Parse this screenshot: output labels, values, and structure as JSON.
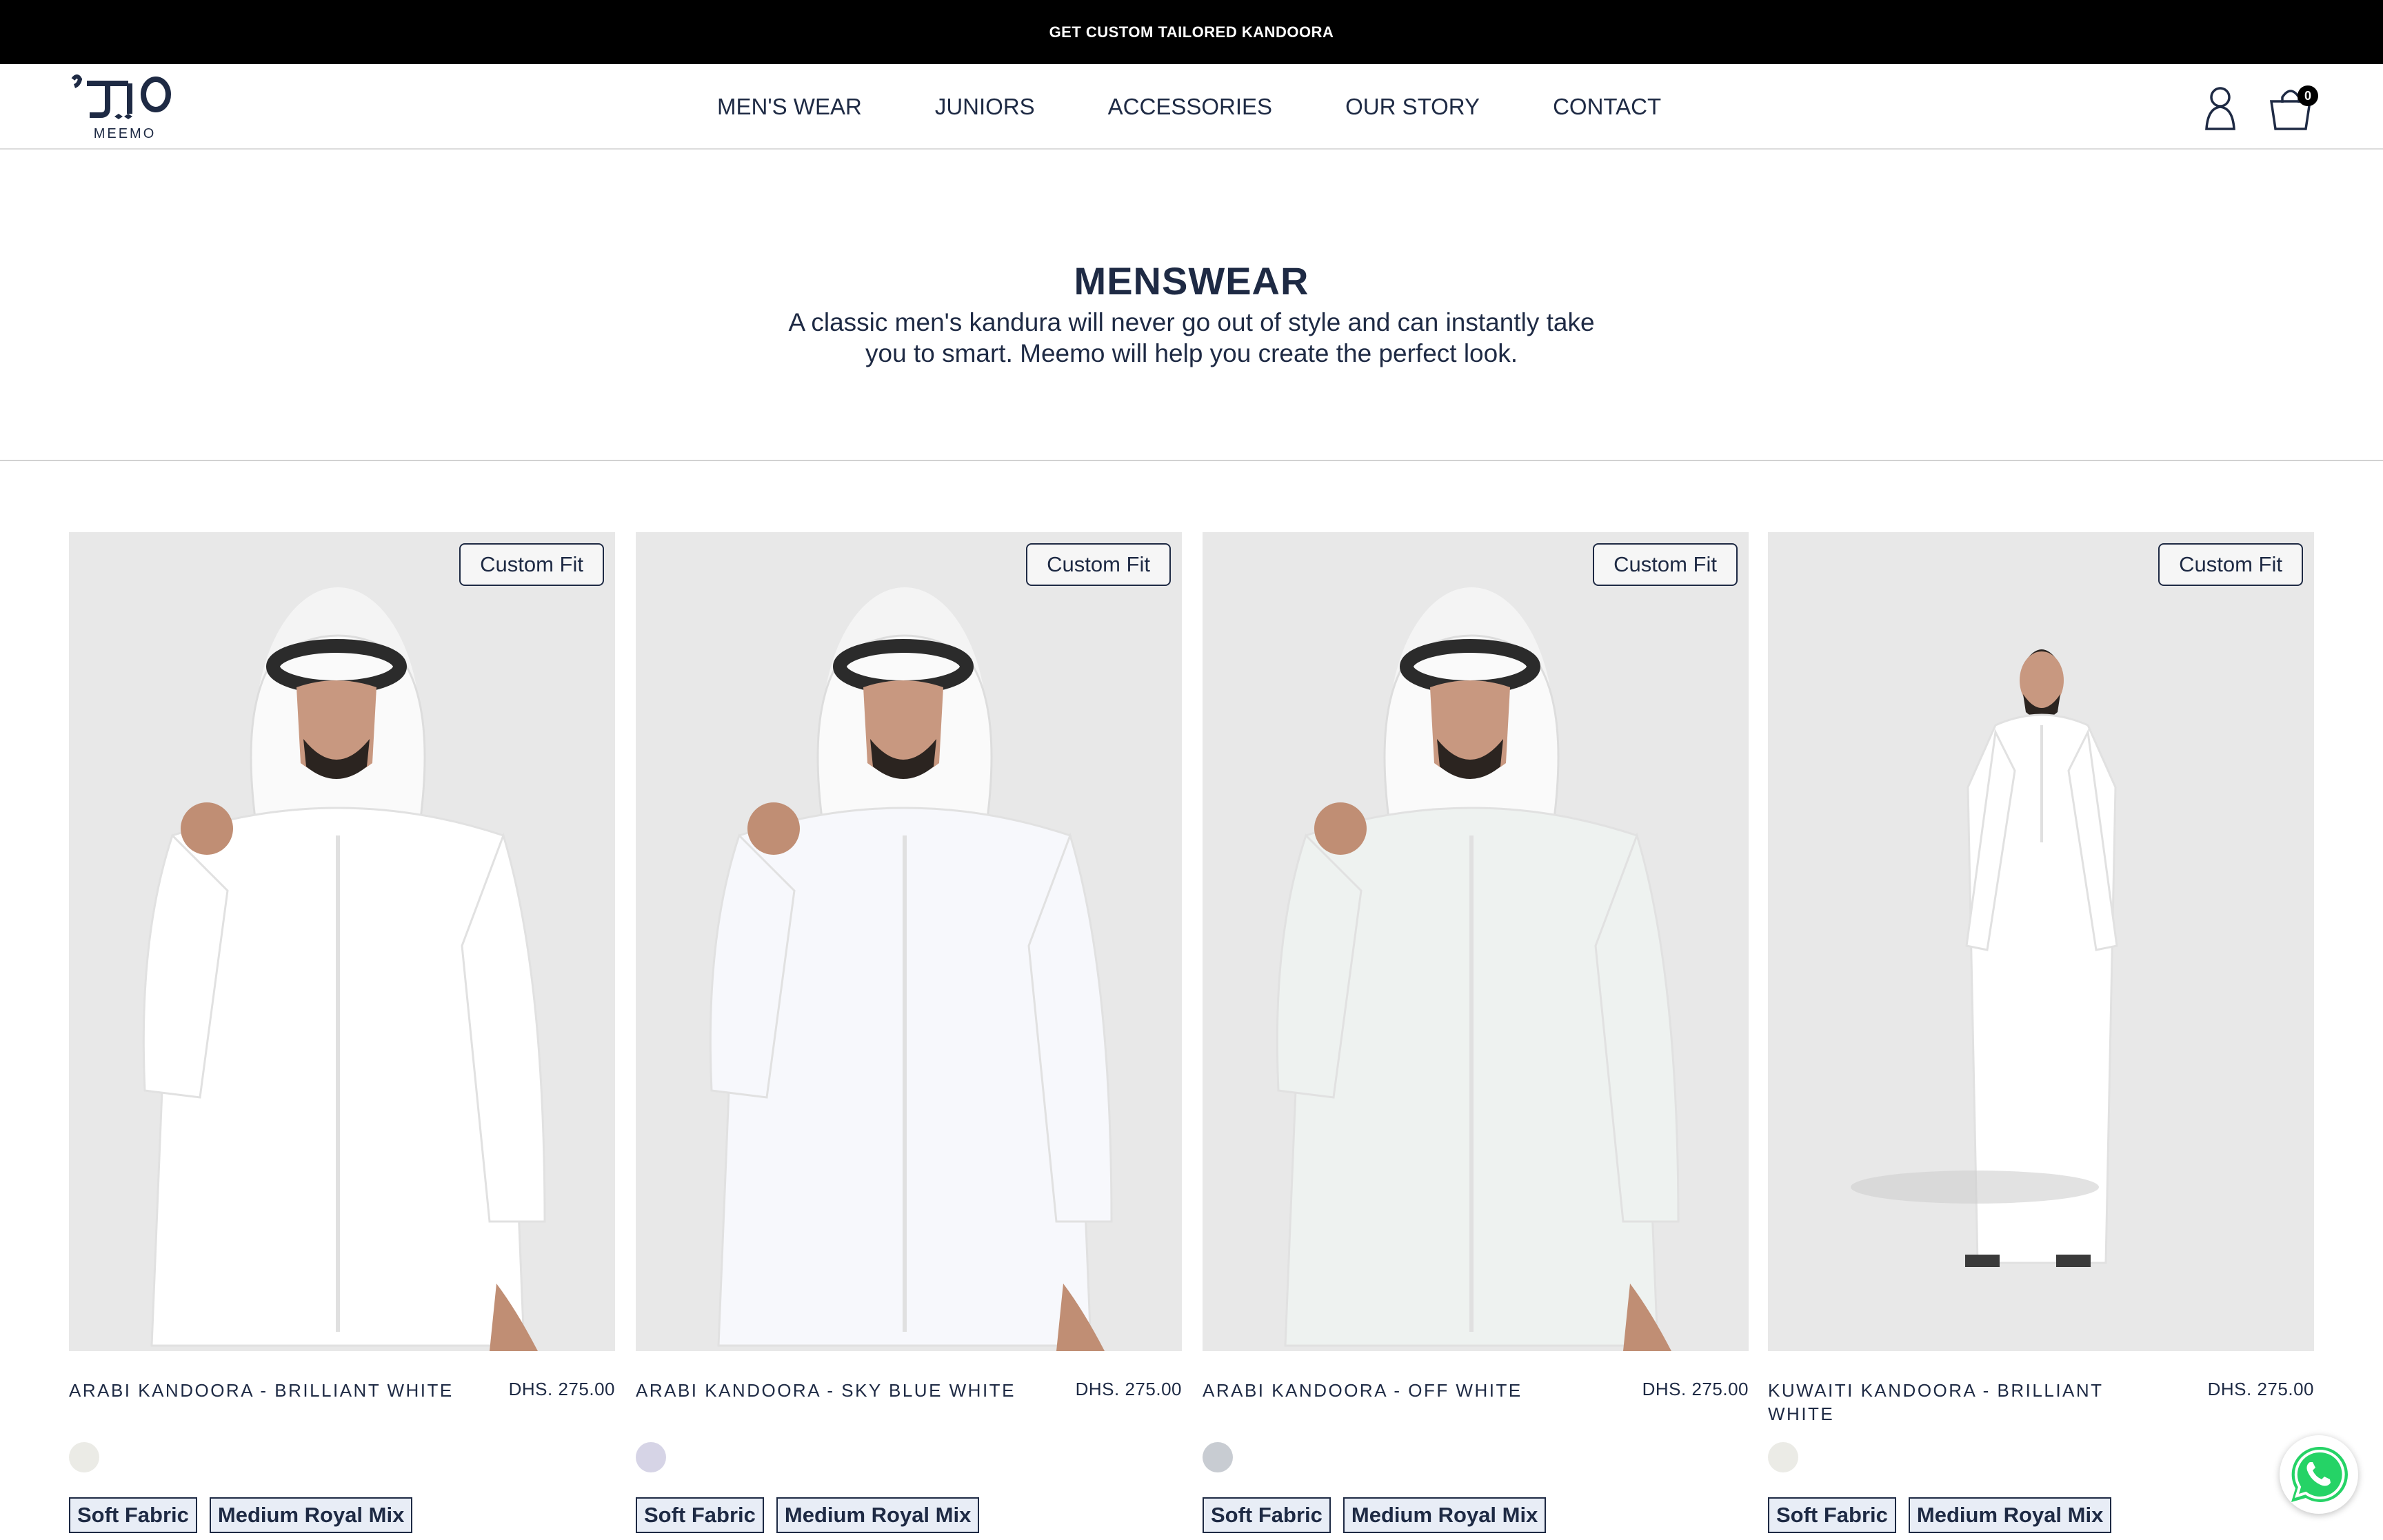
{
  "announcement": {
    "text": "GET CUSTOM TAILORED KANDOORA"
  },
  "brand": {
    "name": "MEEMO"
  },
  "nav": [
    {
      "label": "MEN'S WEAR"
    },
    {
      "label": "JUNIORS"
    },
    {
      "label": "ACCESSORIES"
    },
    {
      "label": "OUR STORY"
    },
    {
      "label": "CONTACT"
    }
  ],
  "header_icons": {
    "account": "user-icon",
    "cart": "shopping-bag-icon",
    "cart_count": "0"
  },
  "hero": {
    "title": "MENSWEAR",
    "description": "A classic men's kandura will never go out of style and can instantly take you to smart. Meemo will help you create the perfect look."
  },
  "products": [
    {
      "badge": "Custom Fit",
      "name": "ARABI KANDOORA - BRILLIANT WHITE",
      "price": "DHS. 275.00",
      "swatch_color": "#ebebe6",
      "tags": [
        "Soft Fabric",
        "Medium Royal Mix"
      ],
      "garment_color": "#ffffff",
      "style": "arabi"
    },
    {
      "badge": "Custom Fit",
      "name": "ARABI KANDOORA - SKY BLUE WHITE",
      "price": "DHS. 275.00",
      "swatch_color": "#d6d4e6",
      "tags": [
        "Soft Fabric",
        "Medium Royal Mix"
      ],
      "garment_color": "#f7f8fc",
      "style": "arabi"
    },
    {
      "badge": "Custom Fit",
      "name": "ARABI KANDOORA - OFF WHITE",
      "price": "DHS. 275.00",
      "swatch_color": "#c8ccd2",
      "tags": [
        "Soft Fabric",
        "Medium Royal Mix"
      ],
      "garment_color": "#eef2f0",
      "style": "arabi"
    },
    {
      "badge": "Custom Fit",
      "name": "KUWAITI KANDOORA - BRILLIANT WHITE",
      "price": "DHS. 275.00",
      "swatch_color": "#ebebe6",
      "tags": [
        "Soft Fabric",
        "Medium Royal Mix"
      ],
      "garment_color": "#ffffff",
      "style": "kuwaiti"
    }
  ],
  "colors": {
    "announcement_bg": "#000000",
    "text": "#1e2a44",
    "photo_bg": "#e8e8e8",
    "whatsapp": "#25d366"
  },
  "floating": {
    "icon": "whatsapp-icon"
  }
}
